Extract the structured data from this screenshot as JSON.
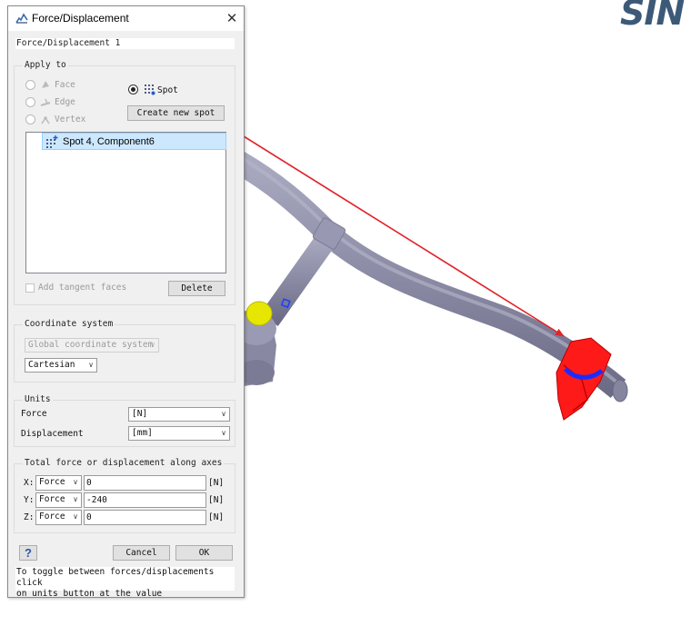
{
  "logo_text": "SIN",
  "dialog": {
    "title": "Force/Displacement",
    "name_value": "Force/Displacement 1",
    "apply_to": {
      "legend": "Apply to",
      "face_label": "Face",
      "edge_label": "Edge",
      "vertex_label": "Vertex",
      "spot_label": "Spot",
      "create_spot_button": "Create new spot",
      "list_items": [
        "Spot 4, Component6"
      ],
      "add_tangent_label": "Add tangent faces",
      "delete_button": "Delete"
    },
    "coordinate_system": {
      "legend": "Coordinate system",
      "system_value": "Global coordinate system",
      "type_value": "Cartesian"
    },
    "units": {
      "legend": "Units",
      "force_label": "Force",
      "force_value": "[N]",
      "displacement_label": "Displacement",
      "displacement_value": "[mm]"
    },
    "axes": {
      "legend": "Total force or displacement along axes",
      "rows": [
        {
          "axis": "X:",
          "mode": "Force",
          "value": "0",
          "unit": "[N]"
        },
        {
          "axis": "Y:",
          "mode": "Force",
          "value": "-240",
          "unit": "[N]"
        },
        {
          "axis": "Z:",
          "mode": "Force",
          "value": "0",
          "unit": "[N]"
        }
      ]
    },
    "help_label": "?",
    "cancel_button": "Cancel",
    "ok_button": "OK",
    "hint_line1": "To toggle between forces/displacements click",
    "hint_line2": "on units button at the value"
  },
  "colors": {
    "arrow": "#e0252b",
    "part": "#8a8aa4",
    "load_marker": "#ff1a1a",
    "selection": "#cce8ff"
  }
}
